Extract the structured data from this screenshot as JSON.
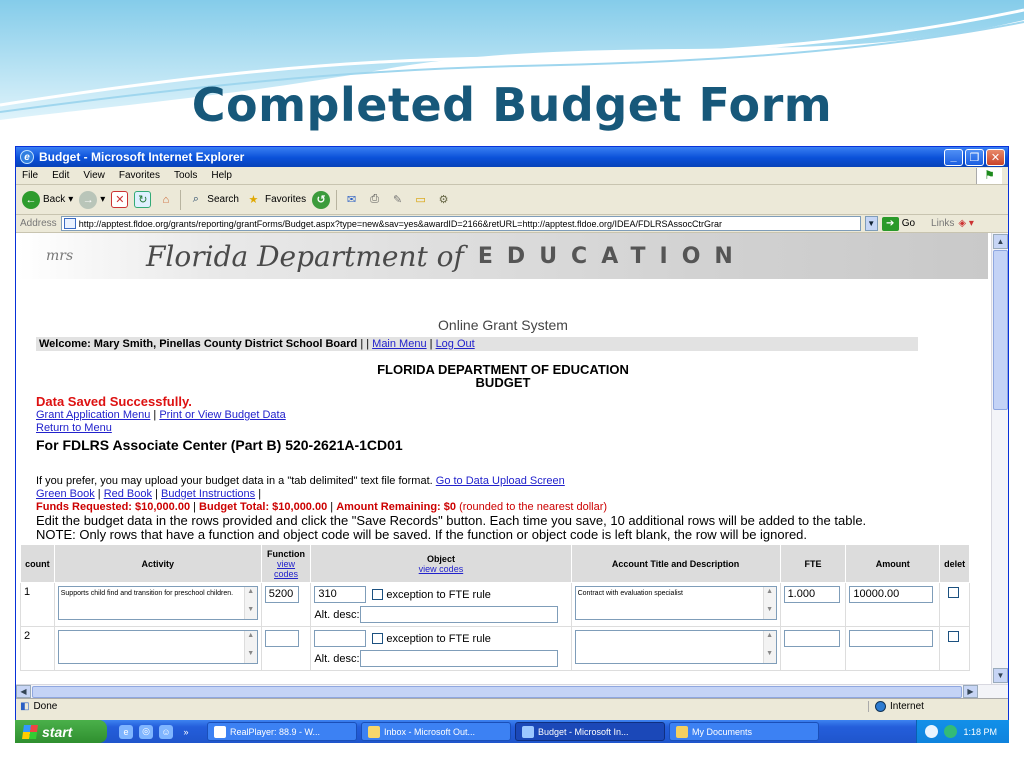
{
  "slide": {
    "title": "Completed Budget Form"
  },
  "window": {
    "title": "Budget - Microsoft Internet Explorer",
    "controls": [
      "_",
      "❐",
      "✕"
    ]
  },
  "menu": [
    "File",
    "Edit",
    "View",
    "Favorites",
    "Tools",
    "Help"
  ],
  "toolbar": {
    "back": "Back",
    "search": "Search",
    "favorites": "Favorites"
  },
  "address": {
    "label": "Address",
    "url": "http://apptest.fldoe.org/grants/reporting/grantForms/Budget.aspx?type=new&sav=yes&awardID=2166&retURL=http://apptest.fldoe.org/IDEA/FDLRSAssocCtrGrar",
    "go": "Go",
    "links": "Links"
  },
  "banner": {
    "logo": "mrs",
    "florida": "Florida Department of",
    "education": "EDUCATION"
  },
  "page": {
    "system_title": "Online Grant System",
    "welcome": "Welcome: Mary Smith, Pinellas County  District School Board",
    "welcome_sep": "| |",
    "main_menu": "Main Menu",
    "pipe": "|",
    "log_out": "Log Out",
    "dept": "FLORIDA DEPARTMENT OF EDUCATION",
    "budget": "BUDGET",
    "saved": "Data Saved Successfully.",
    "grant_menu": "Grant Application Menu",
    "print_budget": "Print or View Budget Data",
    "return_menu": "Return to Menu",
    "for_line": "For FDLRS Associate Center (Part B) 520-2621A-1CD01",
    "upload_text": "If you prefer, you may upload your budget data in a \"tab delimited\" text file format.",
    "upload_link": "Go to Data Upload Screen",
    "green_book": "Green Book",
    "red_book": "Red Book",
    "budget_instructions": "Budget Instructions",
    "trailing_pipe": "|",
    "funds_requested": "Funds Requested: $10,000.00",
    "budget_total": "Budget Total: $10,000.00",
    "amount_remaining": "Amount Remaining: $0",
    "rounded_note": "(rounded to the nearest dollar)",
    "instructions_1": "Edit the budget data in the rows provided and click the \"Save Records\" button. Each time you save, 10 additional rows will be added to the table.",
    "instructions_2": "NOTE: Only rows that have a function and object code will be saved. If the function or object code is left blank, the row will be ignored."
  },
  "table": {
    "headers": {
      "count": "count",
      "activity": "Activity",
      "function": "Function",
      "function_link": "view codes",
      "object": "Object",
      "object_link": "view codes",
      "account": "Account Title and Description",
      "fte": "FTE",
      "amount": "Amount",
      "delete": "delet"
    },
    "exception_label": "exception to FTE rule",
    "alt_desc_label": "Alt. desc:",
    "rows": [
      {
        "count": "1",
        "activity": "Supports child find and transition for preschool children.",
        "function": "5200",
        "object": "310",
        "account": "Contract with evaluation specialist",
        "fte": "1.000",
        "amount": "10000.00"
      },
      {
        "count": "2",
        "activity": "",
        "function": "",
        "object": "",
        "account": "",
        "fte": "",
        "amount": ""
      }
    ]
  },
  "status": {
    "left": "Done",
    "zone": "Internet"
  },
  "taskbar": {
    "start": "start",
    "tasks": [
      "RealPlayer: 88.9 - W...",
      "Inbox - Microsoft Out...",
      "Budget - Microsoft In...",
      "My Documents"
    ],
    "clock": "1:18 PM"
  }
}
